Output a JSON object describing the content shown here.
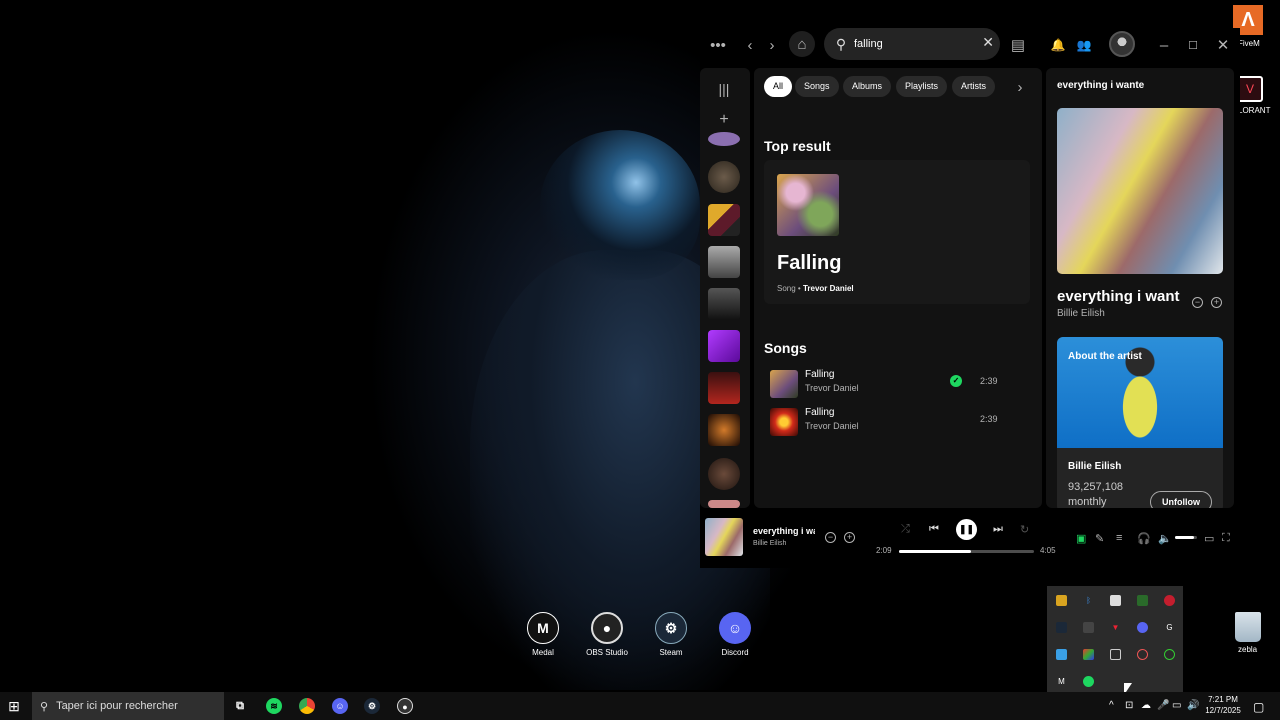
{
  "desktop": {
    "icons": [
      {
        "label": "Medal"
      },
      {
        "label": "OBS Studio"
      },
      {
        "label": "Steam"
      },
      {
        "label": "Discord"
      }
    ],
    "corner_icons": {
      "fivem": "FiveM",
      "valorant": "LORANT",
      "bin": "zebla"
    }
  },
  "spotify": {
    "search": {
      "value": "falling",
      "icon": "search-icon"
    },
    "filters": [
      "All",
      "Songs",
      "Albums",
      "Playlists",
      "Artists"
    ],
    "active_filter": "All",
    "top_result": {
      "heading": "Top result",
      "name": "Falling",
      "type": "Song",
      "separator": " • ",
      "artist": "Trevor Daniel"
    },
    "songs": {
      "heading": "Songs",
      "items": [
        {
          "title": "Falling",
          "artist": "Trevor Daniel",
          "duration": "2:39",
          "saved": true
        },
        {
          "title": "Falling",
          "artist": "Trevor Daniel",
          "duration": "2:39",
          "saved": false
        }
      ]
    },
    "now_playing_view": {
      "header": "everything i wante",
      "title": "everything i want",
      "artist": "Billie Eilish",
      "about_label": "About the artist",
      "about_name": "Billie Eilish",
      "listeners": "93,257,108",
      "listeners_suffix": "monthly",
      "unfollow_label": "Unfollow"
    },
    "player": {
      "title": "everything i wa",
      "artist": "Billie Eilish",
      "elapsed": "2:09",
      "total": "4:05",
      "progress": 0.53,
      "volume": 0.85
    },
    "colors": {
      "accent": "#1ed760",
      "background": "#121212"
    }
  },
  "taskbar": {
    "search_placeholder": "Taper ici pour rechercher",
    "time": "7:21 PM",
    "date": "12/7/2025"
  }
}
